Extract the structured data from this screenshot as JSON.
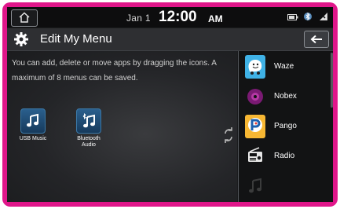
{
  "status": {
    "date": "Jan 1",
    "time": "12:00",
    "ampm": "AM",
    "icons": [
      "home-icon",
      "battery-icon",
      "bluetooth-icon",
      "signal-icon"
    ]
  },
  "header": {
    "title": "Edit My Menu",
    "icons": [
      "gear-icon",
      "back-arrow-icon"
    ]
  },
  "main": {
    "instruction": "You can add, delete or move apps by dragging the icons. A maximum of 8 menus can be saved.",
    "apps": [
      {
        "label": "USB Music",
        "icon": "music-note-icon"
      },
      {
        "label": "Bluetooth Audio",
        "icon": "bluetooth-music-icon"
      }
    ]
  },
  "menu_list": {
    "items": [
      {
        "label": "Waze",
        "icon": "waze-icon",
        "color": "#3fb2e6"
      },
      {
        "label": "Nobex",
        "icon": "nobex-icon",
        "color": "#7a1a73"
      },
      {
        "label": "Pango",
        "icon": "pango-icon",
        "color": "#f7b733"
      },
      {
        "label": "Radio",
        "icon": "radio-icon",
        "color": "#2a5f8d"
      },
      {
        "label": "",
        "icon": "music-note-icon",
        "color": "#3a3a3c"
      }
    ]
  },
  "colors": {
    "frame": "#e0168a",
    "screen": "#1b1c1e",
    "accent_tile": "#2a5f8d"
  }
}
